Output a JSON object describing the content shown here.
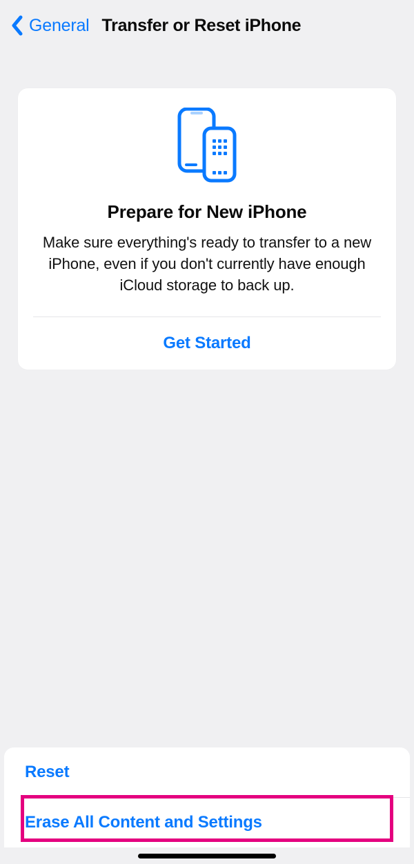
{
  "nav": {
    "back_label": "General",
    "title": "Transfer or Reset iPhone"
  },
  "card": {
    "title": "Prepare for New iPhone",
    "description": "Make sure everything's ready to transfer to a new iPhone, even if you don't currently have enough iCloud storage to back up.",
    "action_label": "Get Started"
  },
  "list": {
    "reset_label": "Reset",
    "erase_label": "Erase All Content and Settings"
  },
  "colors": {
    "accent": "#0a7aff",
    "highlight": "#e4007f",
    "bg": "#f0f0f2"
  }
}
